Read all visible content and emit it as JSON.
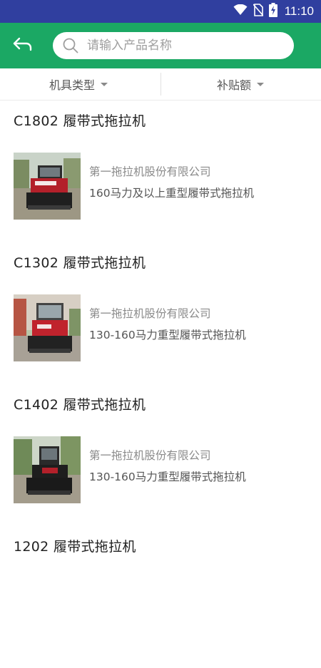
{
  "status_bar": {
    "time": "11:10",
    "icons": [
      "wifi-icon",
      "no-sim-icon",
      "battery-charging-icon"
    ]
  },
  "appbar": {
    "back_icon": "back-arrow-icon",
    "search_placeholder": "请输入产品名称",
    "search_value": ""
  },
  "filters": [
    {
      "label": "机具类型",
      "icon": "caret-down-icon"
    },
    {
      "label": "补贴额",
      "icon": "caret-down-icon"
    }
  ],
  "products": [
    {
      "title": "C1802 履带式拖拉机",
      "company": "第一拖拉机股份有限公司",
      "description": "160马力及以上重型履带式拖拉机"
    },
    {
      "title": "C1302 履带式拖拉机",
      "company": "第一拖拉机股份有限公司",
      "description": "130-160马力重型履带式拖拉机"
    },
    {
      "title": "C1402 履带式拖拉机",
      "company": "第一拖拉机股份有限公司",
      "description": "130-160马力重型履带式拖拉机"
    },
    {
      "title": "1202 履带式拖拉机",
      "company": "",
      "description": ""
    }
  ],
  "colors": {
    "status_bar": "#303f9f",
    "appbar": "#1ba864",
    "tractor_red": "#b3202a"
  }
}
